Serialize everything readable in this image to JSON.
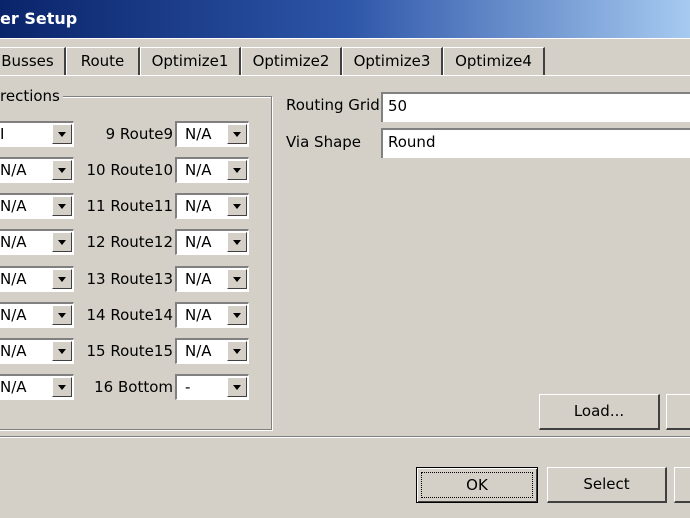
{
  "window": {
    "title": "er Setup"
  },
  "tabs": [
    "Busses",
    "Route",
    "Optimize1",
    "Optimize2",
    "Optimize3",
    "Optimize4"
  ],
  "group_title": "rections",
  "left_values": [
    "I",
    "N/A",
    "N/A",
    "N/A",
    "N/A",
    "N/A",
    "N/A",
    "N/A"
  ],
  "routes": [
    {
      "label": "9 Route9",
      "value": "N/A"
    },
    {
      "label": "10 Route10",
      "value": "N/A"
    },
    {
      "label": "11 Route11",
      "value": "N/A"
    },
    {
      "label": "12 Route12",
      "value": "N/A"
    },
    {
      "label": "13 Route13",
      "value": "N/A"
    },
    {
      "label": "14 Route14",
      "value": "N/A"
    },
    {
      "label": "15 Route15",
      "value": "N/A"
    },
    {
      "label": "16 Bottom",
      "value": "-"
    }
  ],
  "routing_grid": {
    "label": "Routing Grid",
    "value": "50"
  },
  "via_shape": {
    "label": "Via Shape",
    "value": "Round"
  },
  "buttons": {
    "load": "Load...",
    "ok": "OK",
    "select": "Select"
  }
}
